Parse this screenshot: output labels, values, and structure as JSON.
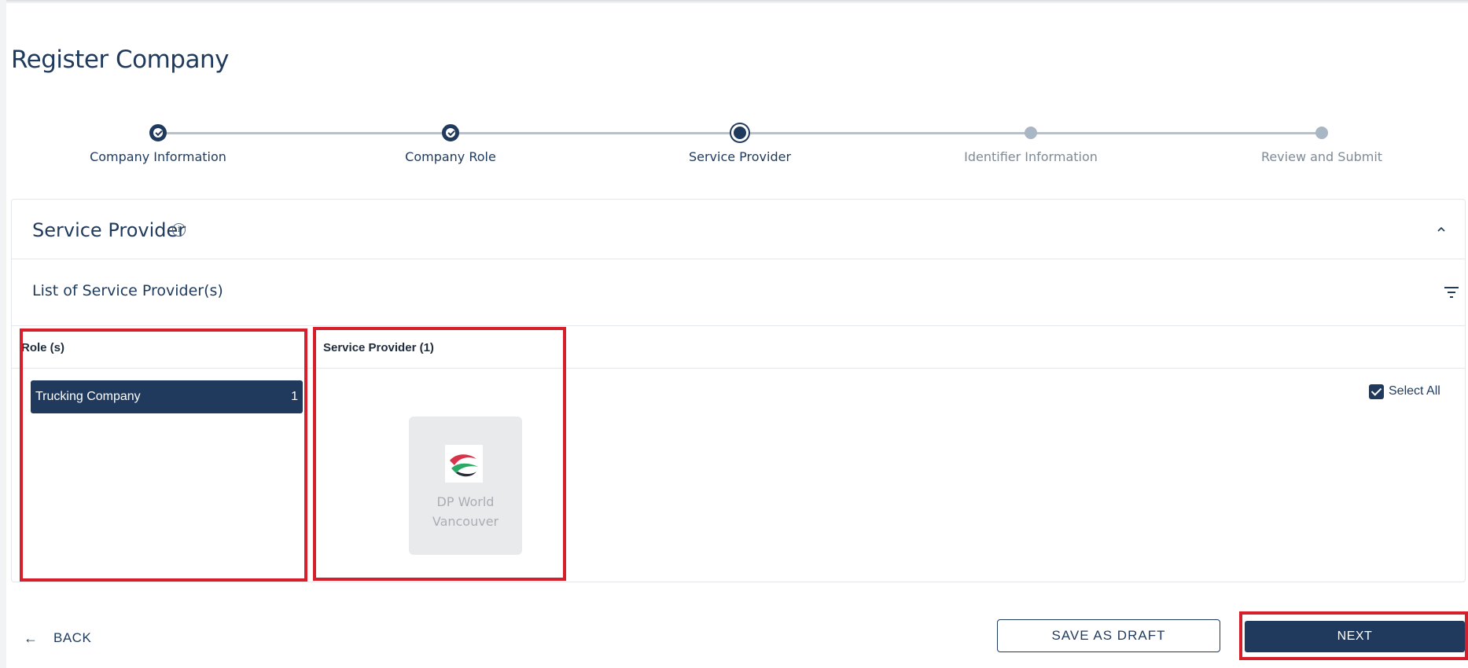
{
  "page": {
    "title": "Register Company"
  },
  "stepper": {
    "steps": [
      {
        "label": "Company Information",
        "state": "done"
      },
      {
        "label": "Company Role",
        "state": "done"
      },
      {
        "label": "Service Provider",
        "state": "current"
      },
      {
        "label": "Identifier Information",
        "state": "todo"
      },
      {
        "label": "Review and Submit",
        "state": "todo"
      }
    ]
  },
  "panel": {
    "title": "Service Provider",
    "info_icon": "info-circle-icon",
    "collapse_icon": "chevron-up-icon",
    "list_title": "List of Service Provider(s)",
    "filter_icon": "filter-icon",
    "roles_header": "Role (s)",
    "providers_header": "Service Provider (1)",
    "roles": [
      {
        "label": "Trucking Company",
        "count": "1"
      }
    ],
    "providers": [
      {
        "name": "DP World Vancouver",
        "logo": "dp-world-logo"
      }
    ],
    "select_all": {
      "label": "Select All",
      "checked": true
    }
  },
  "footer": {
    "back_label": "BACK",
    "back_icon": "arrow-left-icon",
    "save_draft_label": "SAVE AS DRAFT",
    "next_label": "NEXT"
  },
  "colors": {
    "primary": "#1f3a5c",
    "highlight": "#d71f2b",
    "card_bg": "#e9eaec"
  }
}
